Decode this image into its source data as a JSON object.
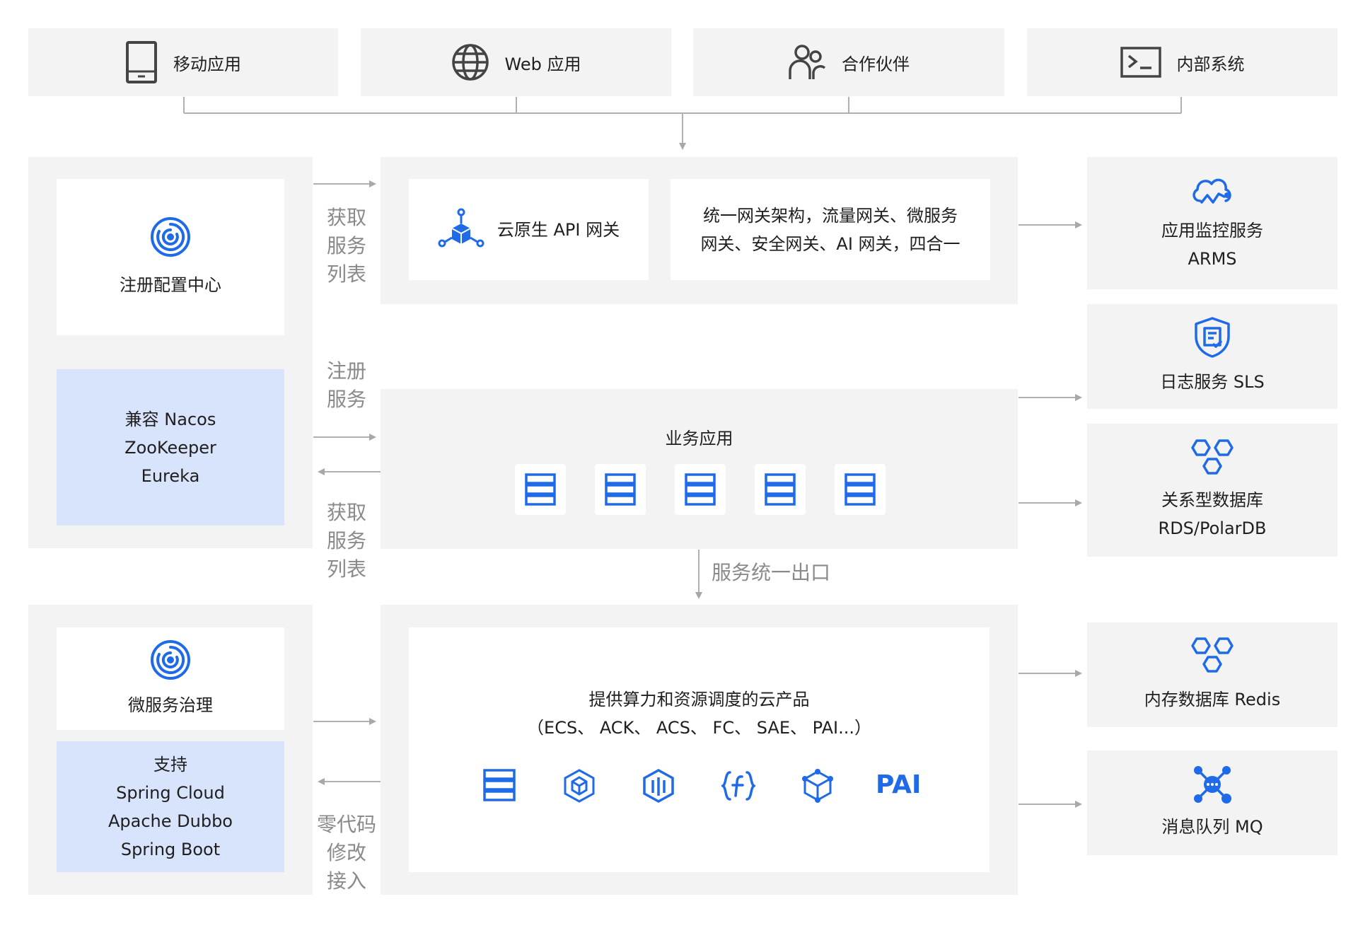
{
  "clients": [
    {
      "label": "移动应用",
      "icon": "mobile-phone-icon"
    },
    {
      "label": "Web 应用",
      "icon": "globe-icon"
    },
    {
      "label": "合作伙伴",
      "icon": "partners-icon"
    },
    {
      "label": "内部系统",
      "icon": "terminal-icon"
    }
  ],
  "registry": {
    "title": "注册配置中心",
    "compat_lines": [
      "兼容 Nacos",
      "ZooKeeper",
      "Eureka"
    ]
  },
  "governance": {
    "title": "微服务治理",
    "support_lines": [
      "支持",
      "Spring Cloud",
      "Apache Dubbo",
      "Spring Boot"
    ]
  },
  "arrow_labels": {
    "fetch_top": [
      "获取",
      "服务",
      "列表"
    ],
    "register": [
      "注册",
      "服务"
    ],
    "fetch_bottom": [
      "获取",
      "服务",
      "列表"
    ],
    "zero_code": [
      "零代码",
      "修改",
      "接入"
    ],
    "egress": "服务统一出口"
  },
  "gateway": {
    "title": "云原生 API 网关",
    "desc_lines": [
      "统一网关架构，流量网关、微服务",
      "网关、安全网关、AI 网关，四合一"
    ]
  },
  "business": {
    "title": "业务应用",
    "server_count_icons": [
      "server-icon",
      "server-icon",
      "server-icon",
      "server-icon",
      "server-icon"
    ]
  },
  "compute": {
    "title": "提供算力和资源调度的云产品",
    "subtitle": "（ECS、 ACK、 ACS、 FC、 SAE、 PAI...）",
    "icons": [
      "ecs-server-icon",
      "ack-cube-icon",
      "acs-container-icon",
      "fc-function-icon",
      "sae-cube-icon"
    ],
    "pai_label": "PAI"
  },
  "right_services": [
    {
      "lines": [
        "应用监控服务",
        "ARMS"
      ],
      "icon": "cloud-monitor-icon"
    },
    {
      "lines": [
        "日志服务 SLS"
      ],
      "icon": "shield-log-icon"
    },
    {
      "lines": [
        "关系型数据库",
        "RDS/PolarDB"
      ],
      "icon": "hexagon-db-icon"
    },
    {
      "lines": [
        "内存数据库 Redis"
      ],
      "icon": "hexagon-redis-icon"
    },
    {
      "lines": [
        "消息队列 MQ"
      ],
      "icon": "message-queue-icon"
    }
  ],
  "colors": {
    "accent": "#1e6ae8",
    "panel_gray": "#f3f3f3",
    "panel_blue": "#d8e3fc",
    "connector": "#b0b0b0",
    "label_gray": "#8a8a8a"
  }
}
